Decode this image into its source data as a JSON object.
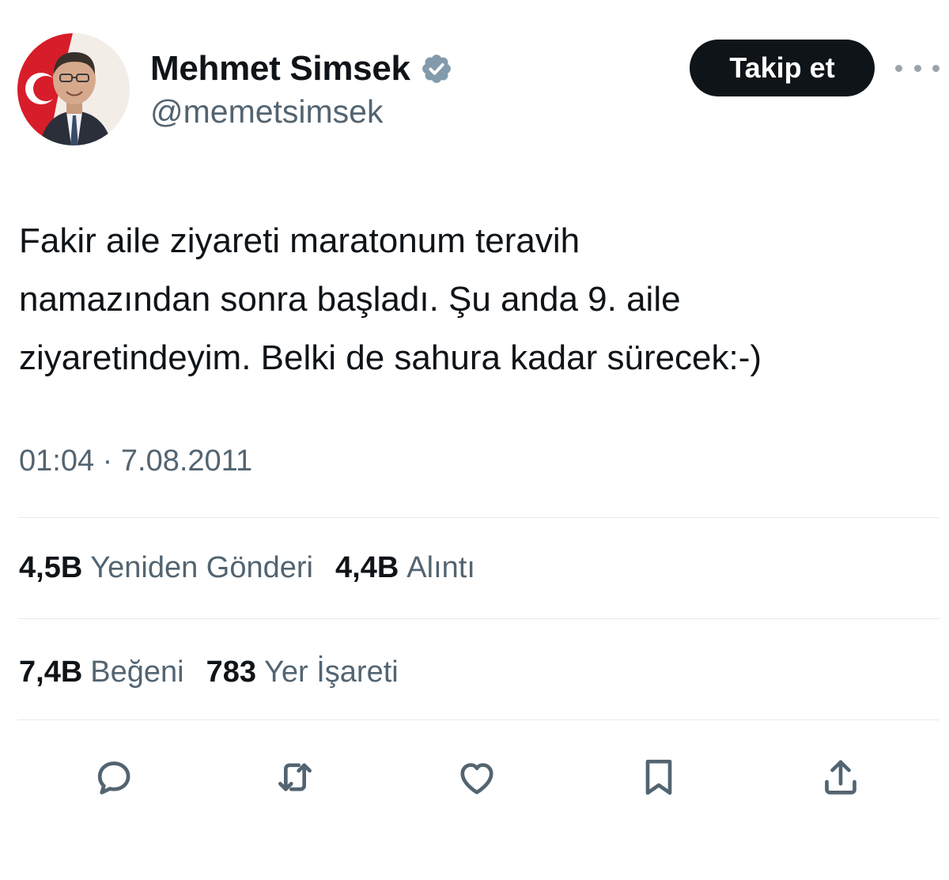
{
  "user": {
    "display_name": "Mehmet Simsek",
    "handle": "@memetsimsek",
    "verified_color": "#829aab"
  },
  "header": {
    "follow_label": "Takip et"
  },
  "tweet": {
    "text": "Fakir aile ziyareti maratonum teravih\nnamazından sonra başladı. Şu anda 9. aile\nziyaretindeyim. Belki de sahura kadar sürecek:-)",
    "time": "01:04",
    "separator": "·",
    "date": "7.08.2011"
  },
  "stats": {
    "reposts_count": "4,5B",
    "reposts_label": "Yeniden Gönderi",
    "quotes_count": "4,4B",
    "quotes_label": "Alıntı",
    "likes_count": "7,4B",
    "likes_label": "Beğeni",
    "bookmarks_count": "783",
    "bookmarks_label": "Yer İşareti"
  },
  "actions": {
    "icons": [
      "reply-icon",
      "retweet-icon",
      "like-icon",
      "bookmark-icon",
      "share-icon"
    ]
  },
  "colors": {
    "text_primary": "#0f1419",
    "text_secondary": "#536471",
    "button_bg": "#0f1419",
    "button_text": "#ffffff",
    "divider": "#e6e9ec"
  }
}
